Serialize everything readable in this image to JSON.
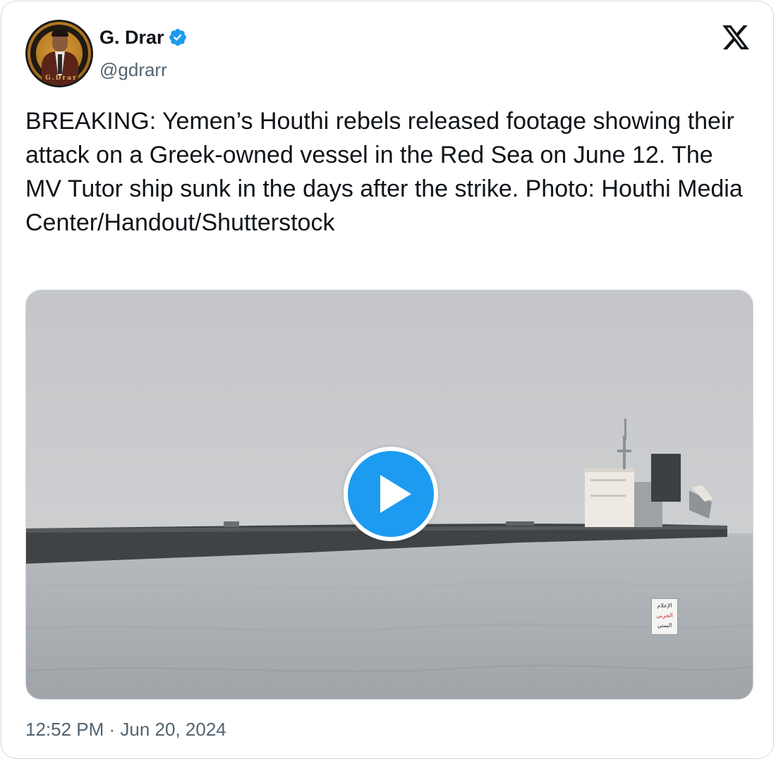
{
  "author": {
    "display_name": "G. Drar",
    "handle": "@gdrarr",
    "verified": true,
    "avatar_icon": "profile-photo-icon",
    "avatar_ring_text": "G.Drar"
  },
  "platform": {
    "logo_icon": "x-logo-icon"
  },
  "tweet": {
    "text": "BREAKING: Yemen’s Houthi rebels released footage showing their attack on a Greek-owned vessel in the Red Sea on June 12. The MV Tutor ship sunk in the days after the strike. Photo: Houthi Media Center/Handout/Shutterstock",
    "timestamp": "12:52 PM · Jun 20, 2024"
  },
  "media": {
    "type": "video",
    "play_icon": "play-icon",
    "watermark_lines": [
      "الإعلام",
      "الحربي",
      "اليمني"
    ]
  },
  "colors": {
    "accent": "#1d9bf0",
    "text_primary": "#0f1419",
    "text_secondary": "#536471",
    "border": "#cfd9de"
  }
}
